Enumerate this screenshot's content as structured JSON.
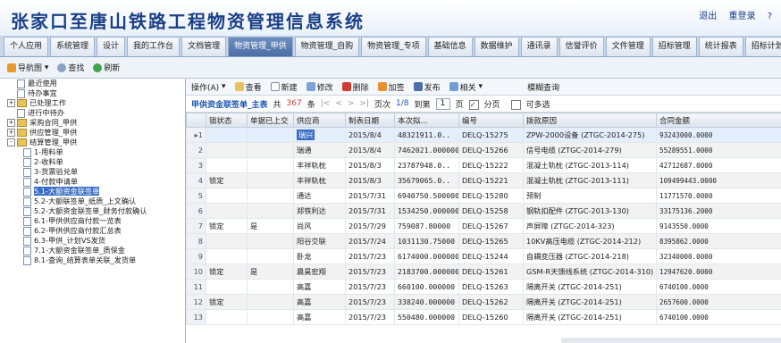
{
  "header": {
    "title": "张家口至唐山铁路工程物资管理信息系统",
    "logout": "退出",
    "relogin": "重登录",
    "help": "?"
  },
  "tabs": [
    "个人应用",
    "系统管理",
    "设计",
    "我的工作台",
    "文档管理",
    "物资管理_甲供",
    "物资管理_自购",
    "物资管理_专项",
    "基础信息",
    "数据维护",
    "通讯录",
    "信誉评价",
    "文件管理",
    "招标管理",
    "统计报表",
    "招标计划"
  ],
  "active_tab": 5,
  "subbar": {
    "nav": "导航图",
    "search": "查找",
    "refresh": "刷新"
  },
  "tree": [
    {
      "label": "最近使用",
      "level": 1,
      "type": "doc"
    },
    {
      "label": "待办事宜",
      "level": 1,
      "type": "doc"
    },
    {
      "label": "已处理工作",
      "level": 1,
      "type": "folder",
      "exp": "+"
    },
    {
      "label": "进行中待办",
      "level": 1,
      "type": "doc"
    },
    {
      "label": "采购合同_甲供",
      "level": 1,
      "type": "folder",
      "exp": "+"
    },
    {
      "label": "供应管理_甲供",
      "level": 1,
      "type": "folder",
      "exp": "+"
    },
    {
      "label": "结算管理_甲供",
      "level": 1,
      "type": "folder",
      "exp": "-"
    },
    {
      "label": "1-用料单",
      "level": 2,
      "type": "doc"
    },
    {
      "label": "2-收料单",
      "level": 2,
      "type": "doc"
    },
    {
      "label": "3-货票验兑单",
      "level": 2,
      "type": "doc"
    },
    {
      "label": "4-付款申请单",
      "level": 2,
      "type": "doc"
    },
    {
      "label": "5.1-大额资金联签单",
      "level": 2,
      "type": "doc",
      "selected": true
    },
    {
      "label": "5.2-大额联签单_纸质_上文确认",
      "level": 2,
      "type": "doc"
    },
    {
      "label": "5.2-大额资金联签单_财务付款确认",
      "level": 2,
      "type": "doc"
    },
    {
      "label": "6.1-甲供供应商付款一览表",
      "level": 2,
      "type": "doc"
    },
    {
      "label": "6.2-甲供供应商付款汇总表",
      "level": 2,
      "type": "doc"
    },
    {
      "label": "6.3-甲供_计划VS发货",
      "level": 2,
      "type": "doc"
    },
    {
      "label": "7.1-大额资金联签单_质保金",
      "level": 2,
      "type": "doc"
    },
    {
      "label": "8.1-查询_结算表单关联_发货单",
      "level": 2,
      "type": "doc"
    }
  ],
  "toolbar": {
    "operate": "操作(A)",
    "view": "查看",
    "new": "新建",
    "edit": "修改",
    "delete": "删除",
    "sign": "加签",
    "publish": "发布",
    "related": "相关",
    "fuzzy": "模糊查询"
  },
  "pager": {
    "title": "甲供资金联签单_主表",
    "total_label": "共",
    "total": "367",
    "unit": "条",
    "page_label": "页次",
    "page": "1/8",
    "goto": "到第",
    "page_input": "1",
    "page_unit": "页",
    "paging": "分页",
    "multi": "可多选"
  },
  "columns": [
    "锁状态",
    "单据已上交",
    "供应商",
    "制表日期",
    "本次拟...",
    "编号",
    "拨款原因",
    "合同金额"
  ],
  "rows": [
    [
      "",
      "",
      "瑞兴",
      "2015/8/4",
      "48321911.0..",
      "DELQ-15275",
      "ZPW-2000设备 (ZTGC-2014-275)",
      "93243000.0000"
    ],
    [
      "",
      "",
      "瑞通",
      "2015/8/4",
      "7462021.000000",
      "DELQ-15266",
      "信号电缆 (ZTGC-2014-279)",
      "55289551.0000"
    ],
    [
      "",
      "",
      "丰祥轨枕",
      "2015/8/3",
      "23787948.0..",
      "DELQ-15222",
      "混凝土轨枕 (ZTGC-2013-114)",
      "42712687.0000"
    ],
    [
      "锁定",
      "",
      "丰祥轨枕",
      "2015/8/3",
      "35679065.0..",
      "DELQ-15221",
      "混凝土轨枕 (ZTGC-2013-111)",
      "109499443.0000"
    ],
    [
      "",
      "",
      "通达",
      "2015/7/31",
      "6940750.500000",
      "DELQ-15280",
      "预制",
      "11771570.0000"
    ],
    [
      "",
      "",
      "郑铁利达",
      "2015/7/31",
      "1534250.000000",
      "DELQ-15258",
      "钢轨扣配件 (ZTGC-2013-130)",
      "33175136.2000"
    ],
    [
      "锁定",
      "是",
      "尚风",
      "2015/7/29",
      "759087.80000",
      "DELQ-15267",
      "声屏障 (ZTGC-2014-323)",
      "9143550.0000"
    ],
    [
      "",
      "",
      "阳谷交联",
      "2015/7/24",
      "1031130.75000",
      "DELQ-15265",
      "10KV高压电缆 (ZTGC-2014-212)",
      "8395862.0000"
    ],
    [
      "",
      "",
      "卧龙",
      "2015/7/23",
      "6174000.000000",
      "DELQ-15244",
      "自耦变压器 (ZTGC-2014-218)",
      "32340000.0000"
    ],
    [
      "锁定",
      "是",
      "晨昊宏翔",
      "2015/7/23",
      "2183700.000000",
      "DELQ-15261",
      "GSM-R天馈线系统 (ZTGC-2014-310)",
      "12947620.0000"
    ],
    [
      "",
      "",
      "高嘉",
      "2015/7/23",
      "660100.000000",
      "DELQ-15263",
      "隔离开关 (ZTGC-2014-251)",
      "6740100.0000"
    ],
    [
      "锁定",
      "",
      "高嘉",
      "2015/7/23",
      "338240.000000",
      "DELQ-15262",
      "隔离开关 (ZTGC-2014-251)",
      "2657600.0000"
    ],
    [
      "",
      "",
      "高嘉",
      "2015/7/23",
      "550480.000000",
      "DELQ-15260",
      "隔离开关 (ZTGC-2014-251)",
      "6740100.0000"
    ]
  ],
  "colors": {
    "title": "#1b3f86",
    "active_tab": "#4b6ea6",
    "selection": "#3a6ec6"
  }
}
